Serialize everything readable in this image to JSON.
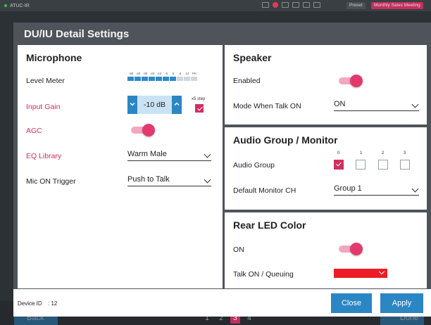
{
  "app": {
    "title": "ATUC-IR",
    "preset_label": "Preset",
    "meeting_label": "Monthly Sales Meeting",
    "back_label": "Back",
    "done_label": "Done",
    "pages": [
      "1",
      "2",
      "3",
      "4"
    ],
    "active_page": "3"
  },
  "dialog": {
    "title": "DU/IU Detail Settings",
    "device_id_label": "Device ID",
    "device_id_value": ": 12",
    "close_label": "Close",
    "apply_label": "Apply"
  },
  "microphone": {
    "title": "Microphone",
    "level_meter_label": "Level Meter",
    "meter_scale": [
      "-50",
      "-40",
      "-30",
      "-20",
      "-12",
      "-6",
      "0",
      "6",
      "12",
      "PK"
    ],
    "meter_active_segments": 7,
    "input_gain_label": "Input Gain",
    "input_gain_value": "-10 dB",
    "x5_step_label": "x5 step",
    "x5_step_checked": true,
    "agc_label": "AGC",
    "agc_on": true,
    "eq_library_label": "EQ Library",
    "eq_library_value": "Warm Male",
    "mic_on_trigger_label": "Mic ON Trigger",
    "mic_on_trigger_value": "Push to Talk"
  },
  "speaker": {
    "title": "Speaker",
    "enabled_label": "Enabled",
    "enabled_on": true,
    "mode_label": "Mode When Talk ON",
    "mode_value": "ON"
  },
  "audio_group": {
    "title": "Audio Group / Monitor",
    "group_label": "Audio Group",
    "channels": [
      "0",
      "1",
      "2",
      "3"
    ],
    "checked": [
      true,
      false,
      false,
      false
    ],
    "monitor_label": "Default Monitor CH",
    "monitor_value": "Group 1"
  },
  "rear_led": {
    "title": "Rear LED Color",
    "on_label": "ON",
    "on_enabled": true,
    "talk_on_label": "Talk ON / Queuing",
    "talk_on_color": "#ee1c25"
  },
  "colors": {
    "accent_blue": "#2b86c4",
    "accent_pink": "#d12f60",
    "toggle_thumb": "#e23a6d"
  }
}
